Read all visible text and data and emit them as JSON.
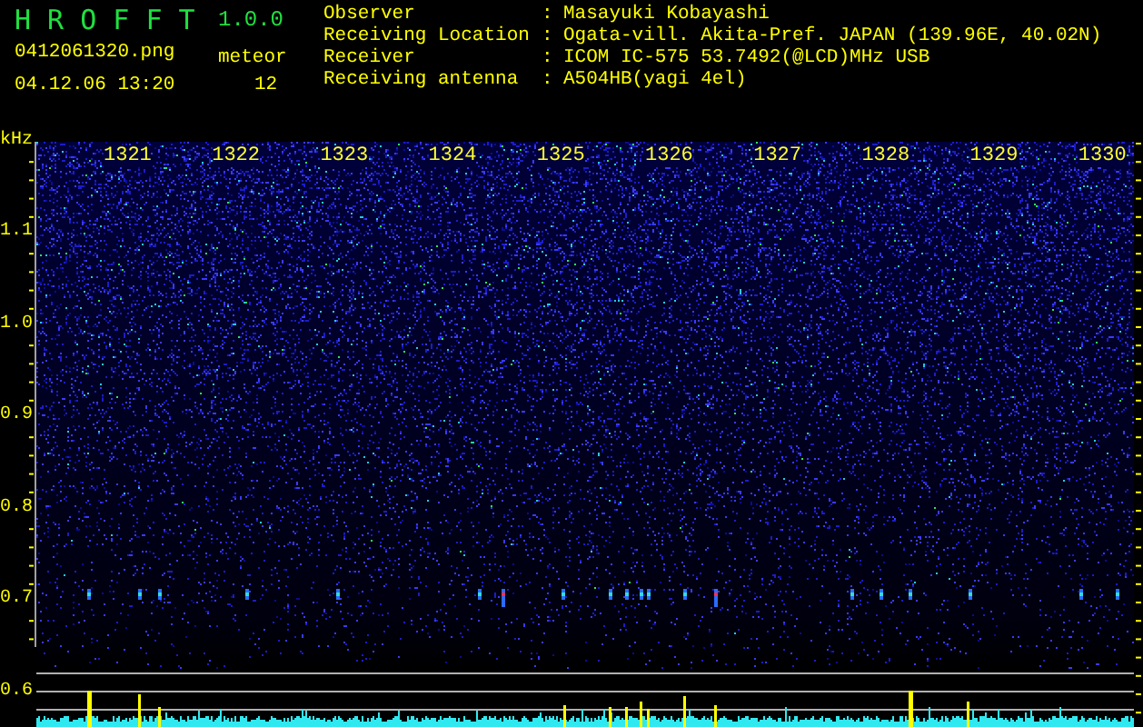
{
  "app": {
    "name": "H R O F F T",
    "version": "1.0.0"
  },
  "file": {
    "name": "0412061320.png",
    "timestamp": "04.12.06 13:20"
  },
  "meteor": {
    "label": "meteor",
    "count": "12"
  },
  "station_info": [
    {
      "label": "Observer",
      "separator": ":",
      "value": "Masayuki Kobayashi"
    },
    {
      "label": "Receiving Location",
      "separator": ":",
      "value": "Ogata-vill. Akita-Pref. JAPAN (139.96E, 40.02N)"
    },
    {
      "label": "Receiver",
      "separator": ":",
      "value": "ICOM IC-575 53.7492(@LCD)MHz USB"
    },
    {
      "label": "Receiving antenna",
      "separator": ":",
      "value": "A504HB(yagi 4el)"
    }
  ],
  "spectrogram": {
    "unit": "kHz",
    "frequency_labels": [
      "1.1",
      "1.0",
      "0.9",
      "0.8",
      "0.7",
      "0.6"
    ],
    "time_labels": [
      "1321",
      "1322",
      "1323",
      "1324",
      "1325",
      "1326",
      "1327",
      "1328",
      "1329",
      "1330"
    ]
  }
}
